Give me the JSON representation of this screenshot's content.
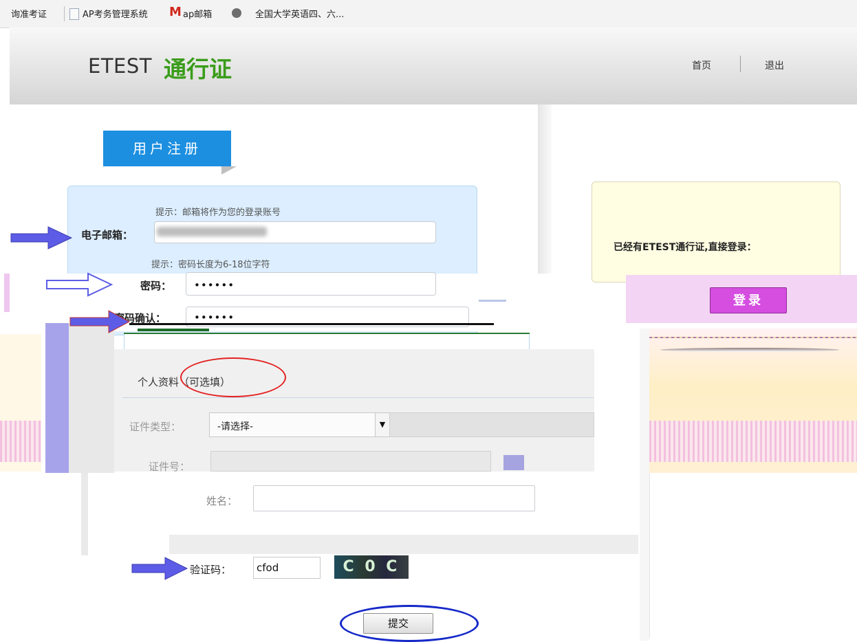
{
  "bookmarks": {
    "item1": "询准考证",
    "item2": "AP考务管理系统",
    "item3": "ap邮箱",
    "item4": "全国大学英语四、六..."
  },
  "header": {
    "logo_latin": "ETEST",
    "logo_cn": "通行证",
    "nav_home": "首页",
    "nav_logout": "退出"
  },
  "register": {
    "tab_label": "用户注册",
    "email_hint": "提示：邮箱将作为您的登录账号",
    "email_label": "电子邮箱：",
    "password_hint": "提示：密码长度为6-18位字符",
    "password_label": "密码：",
    "password_value": "••••••",
    "confirm_label": "密码确认：",
    "confirm_value": "••••••"
  },
  "optional": {
    "section_title": "个人资料（可选填）",
    "id_type_label": "证件类型：",
    "id_type_selected": "-请选择-",
    "id_number_label": "证件号：",
    "name_label": "姓名：",
    "captcha_label": "验证码：",
    "captcha_value": "cfod",
    "captcha_image_text": "C 0 C",
    "submit_label": "提交"
  },
  "login": {
    "prompt": "已经有ETEST通行证,直接登录：",
    "button_label": "登录"
  },
  "colors": {
    "brand_green": "#3a9c1a",
    "tab_blue": "#1c8fe0",
    "login_purple": "#d54ee0",
    "annotation_red": "#e42020",
    "annotation_blue": "#1428c8",
    "arrow_blue": "#5c5ce6"
  },
  "icons": [
    "document-icon",
    "gmail-m-icon",
    "globe-icon",
    "dropdown-arrow-icon",
    "arrow-right-icon"
  ]
}
